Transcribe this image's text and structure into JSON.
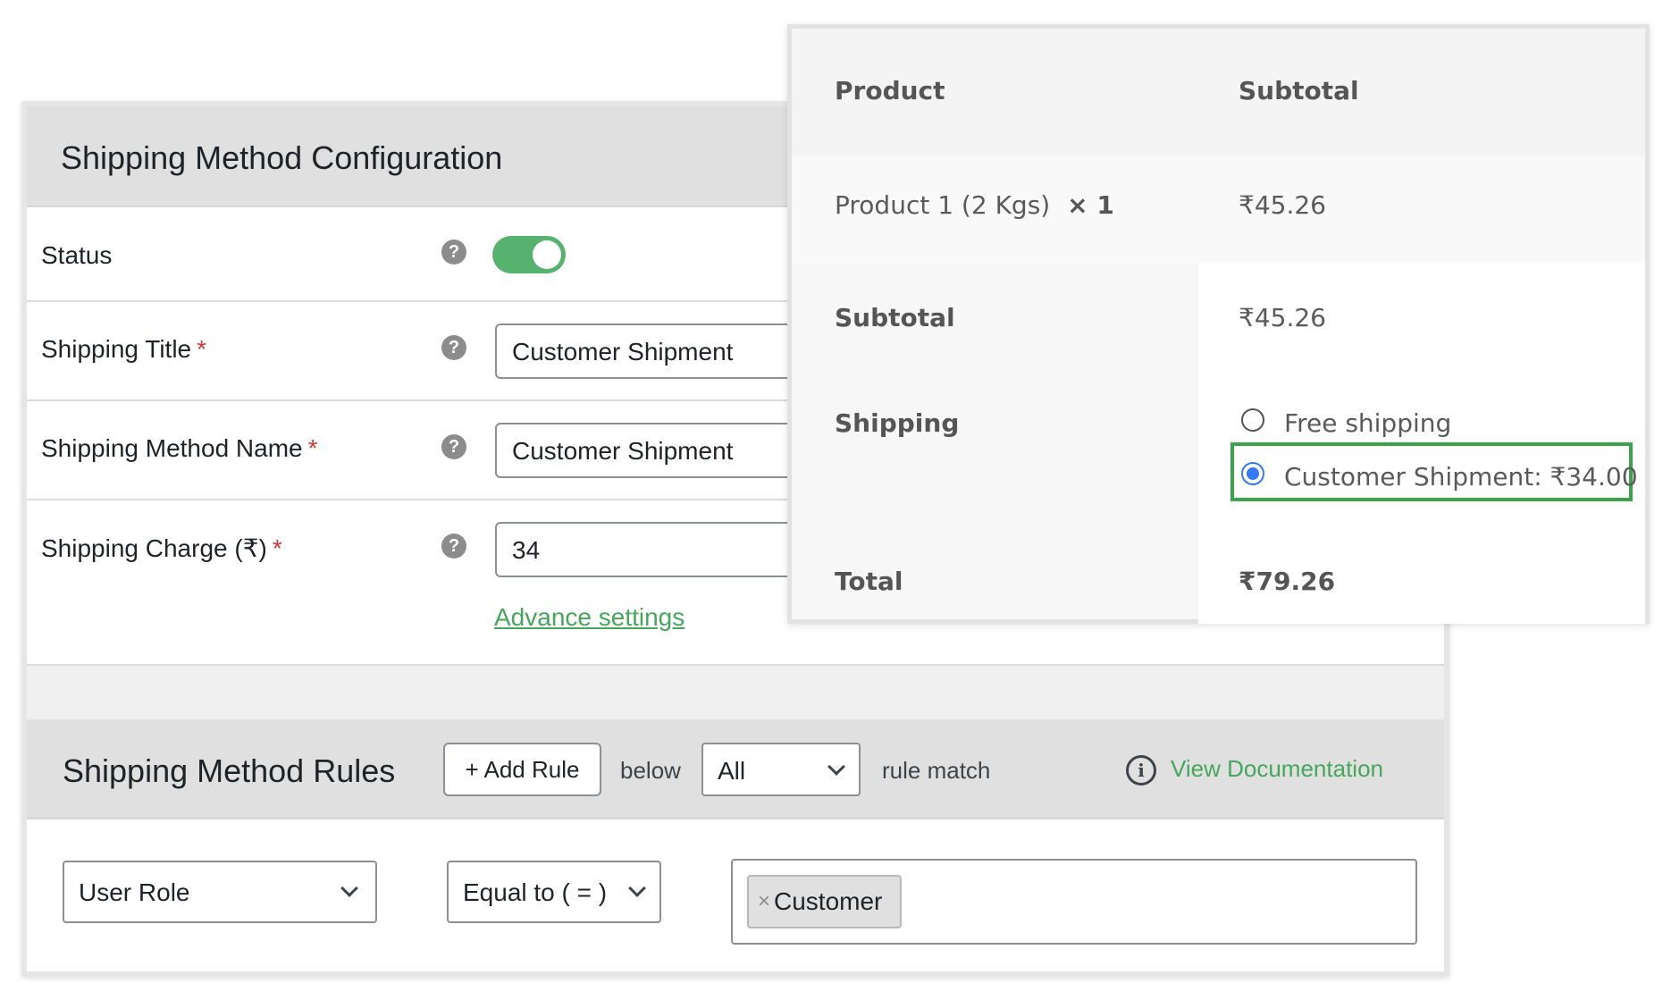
{
  "config": {
    "title": "Shipping Method Configuration",
    "help_glyph": "?",
    "required_mark": "*",
    "status": {
      "label": "Status",
      "enabled": true
    },
    "shipping_title": {
      "label": "Shipping Title",
      "value": "Customer Shipment"
    },
    "method_name": {
      "label": "Shipping Method Name",
      "value": "Customer Shipment"
    },
    "shipping_charge": {
      "label": "Shipping Charge (₹)",
      "value": "34"
    },
    "advance_link": "Advance settings",
    "accent_color": "#57b26f"
  },
  "rules": {
    "title": "Shipping Method Rules",
    "add_rule_label": "+ Add Rule",
    "below_text": "below",
    "match_select": "All",
    "rule_match_text": "rule match",
    "info_glyph": "i",
    "doc_link": "View Documentation",
    "condition_field": "User Role",
    "operator": "Equal to ( = )",
    "tag_remove": "×",
    "tag_value": "Customer"
  },
  "order": {
    "header_product": "Product",
    "header_subtotal": "Subtotal",
    "product_name": "Product 1 (2 Kgs)",
    "product_qty": "× 1",
    "product_price": "₹45.26",
    "subtotal_label": "Subtotal",
    "subtotal_value": "₹45.26",
    "shipping_label": "Shipping",
    "option_free": "Free shipping",
    "option_customer": "Customer Shipment: ₹34.00",
    "selected_option": "Customer Shipment: ₹34.00",
    "total_label": "Total",
    "total_value": "₹79.26",
    "highlight_color": "#3aa34c"
  }
}
